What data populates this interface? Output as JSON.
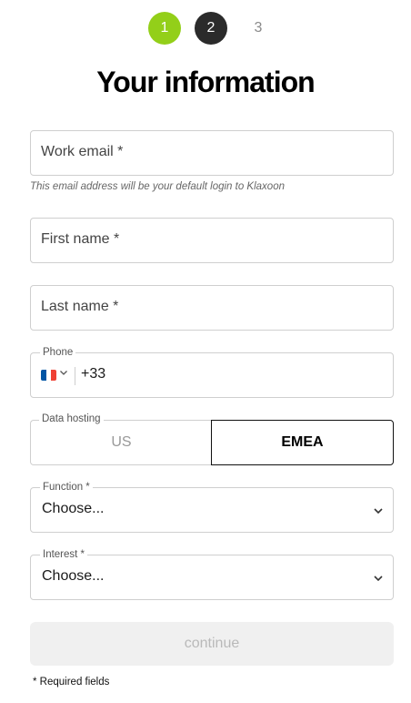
{
  "stepper": {
    "steps": [
      {
        "label": "1",
        "state": "active"
      },
      {
        "label": "2",
        "state": "pending-dark"
      },
      {
        "label": "3",
        "state": "pending"
      }
    ],
    "colors": {
      "active": "#93cf19",
      "dark": "#2b2b2b"
    }
  },
  "title": "Your information",
  "form": {
    "work_email": {
      "placeholder": "Work email *",
      "helper": "This email address will be your default login to Klaxoon"
    },
    "first_name": {
      "placeholder": "First name *"
    },
    "last_name": {
      "placeholder": "Last name *"
    },
    "phone": {
      "label": "Phone",
      "flag_icon": "france-flag-icon",
      "dial_code": "+33"
    },
    "data_hosting": {
      "label": "Data hosting",
      "options": [
        "US",
        "EMEA"
      ],
      "selected": "EMEA"
    },
    "function": {
      "label": "Function *",
      "value": "Choose..."
    },
    "interest": {
      "label": "Interest *",
      "value": "Choose..."
    }
  },
  "continue_label": "continue",
  "required_note": "* Required fields"
}
